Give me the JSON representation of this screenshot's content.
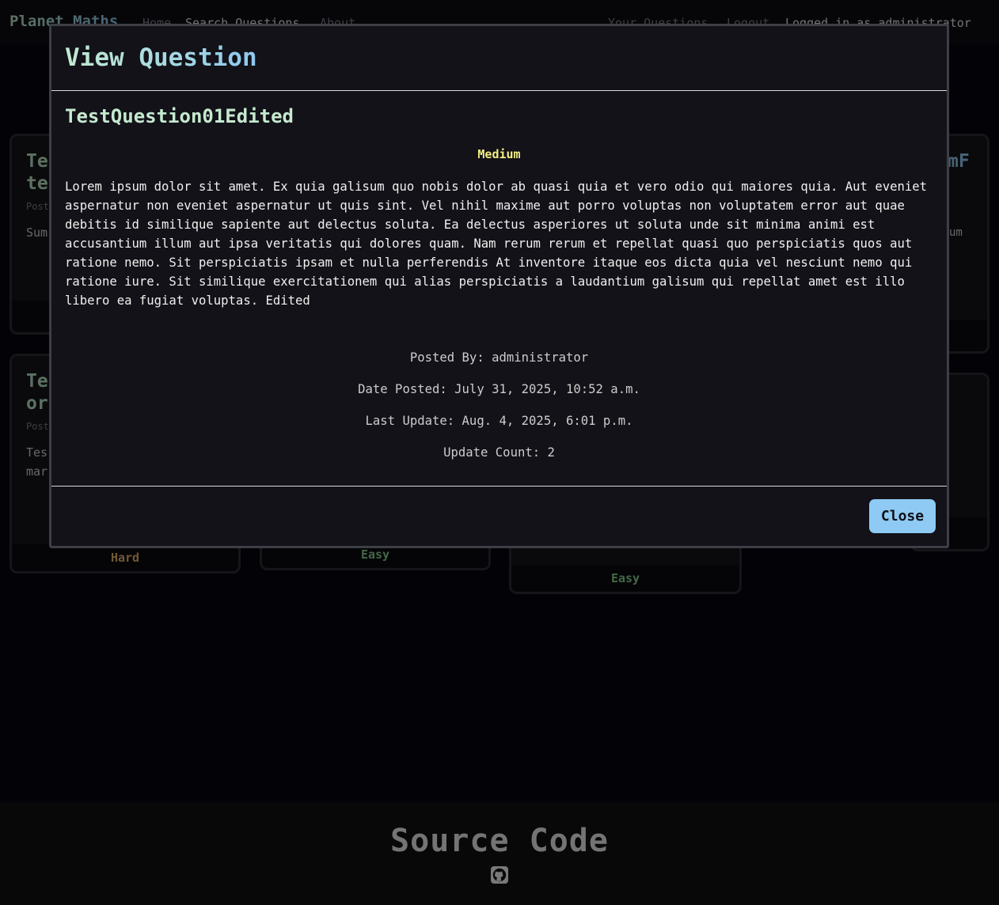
{
  "nav": {
    "brand": "Planet Maths",
    "links": [
      "Home",
      "Search Questions",
      "About"
    ],
    "right_links": [
      "Your Questions",
      "Logout"
    ],
    "status": "Logged in as administrator"
  },
  "cards": [
    {
      "title": "Te\nte",
      "meta": "Post",
      "summary": "Sum"
    },
    {
      "title_right": "mF",
      "summary_right": "um"
    },
    {
      "title": "Te\nor",
      "meta": "Post",
      "summary": "Tes\nmar",
      "difficulty": "Hard"
    },
    {
      "difficulty": "Easy"
    },
    {
      "difficulty": "Easy"
    }
  ],
  "modal": {
    "title": "View Question",
    "question_title": "TestQuestion01Edited",
    "difficulty": "Medium",
    "body": "Lorem ipsum dolor sit amet. Ex quia galisum quo nobis dolor ab quasi quia et vero odio qui maiores quia. Aut eveniet aspernatur non eveniet aspernatur ut quis sint. Vel nihil maxime aut porro voluptas non voluptatem error aut quae debitis id similique sapiente aut delectus soluta. Ea delectus asperiores ut soluta unde sit minima animi est accusantium illum aut ipsa veritatis qui dolores quam. Nam rerum rerum et repellat quasi quo perspiciatis quos aut ratione nemo. Sit perspiciatis ipsam et nulla perferendis At inventore itaque eos dicta quia vel nesciunt nemo qui ratione iure. Sit similique exercitationem qui alias perspiciatis a laudantium galisum qui repellat amet est illo libero ea fugiat voluptas. Edited",
    "posted_by": "Posted By: administrator",
    "date_posted": "Date Posted: July 31, 2025, 10:52 a.m.",
    "last_update": "Last Update: Aug. 4, 2025, 6:01 p.m.",
    "update_count": "Update Count: 2",
    "close_label": "Close"
  },
  "footer": {
    "title": "Source Code",
    "icon": "github-icon"
  },
  "colors": {
    "accent_green": "#b8e3c3",
    "accent_blue": "#8ecaf4",
    "medium": "#f2ee86",
    "hard": "#e3b36b",
    "easy": "#86d08b"
  }
}
